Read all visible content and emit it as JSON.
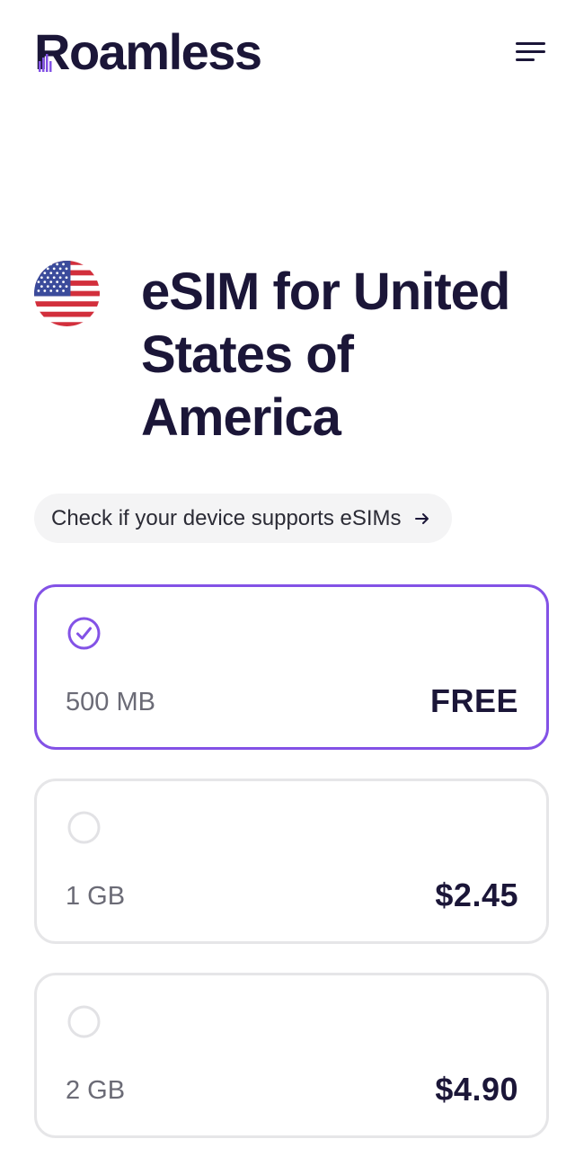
{
  "header": {
    "logo_text": "Roamless",
    "menu_icon": "hamburger-menu-icon"
  },
  "hero": {
    "flag_icon": "us-flag-icon",
    "title": "eSIM for United States of America"
  },
  "device_check": {
    "label": "Check if your device supports eSIMs",
    "icon": "arrow-right-icon"
  },
  "plans": [
    {
      "size": "500 MB",
      "price": "FREE",
      "selected": true
    },
    {
      "size": "1 GB",
      "price": "$2.45",
      "selected": false
    },
    {
      "size": "2 GB",
      "price": "$4.90",
      "selected": false
    }
  ],
  "colors": {
    "brand_dark": "#1b1638",
    "accent_purple": "#8352e6",
    "border": "#e6e6e8",
    "pill_bg": "#f4f4f5"
  }
}
